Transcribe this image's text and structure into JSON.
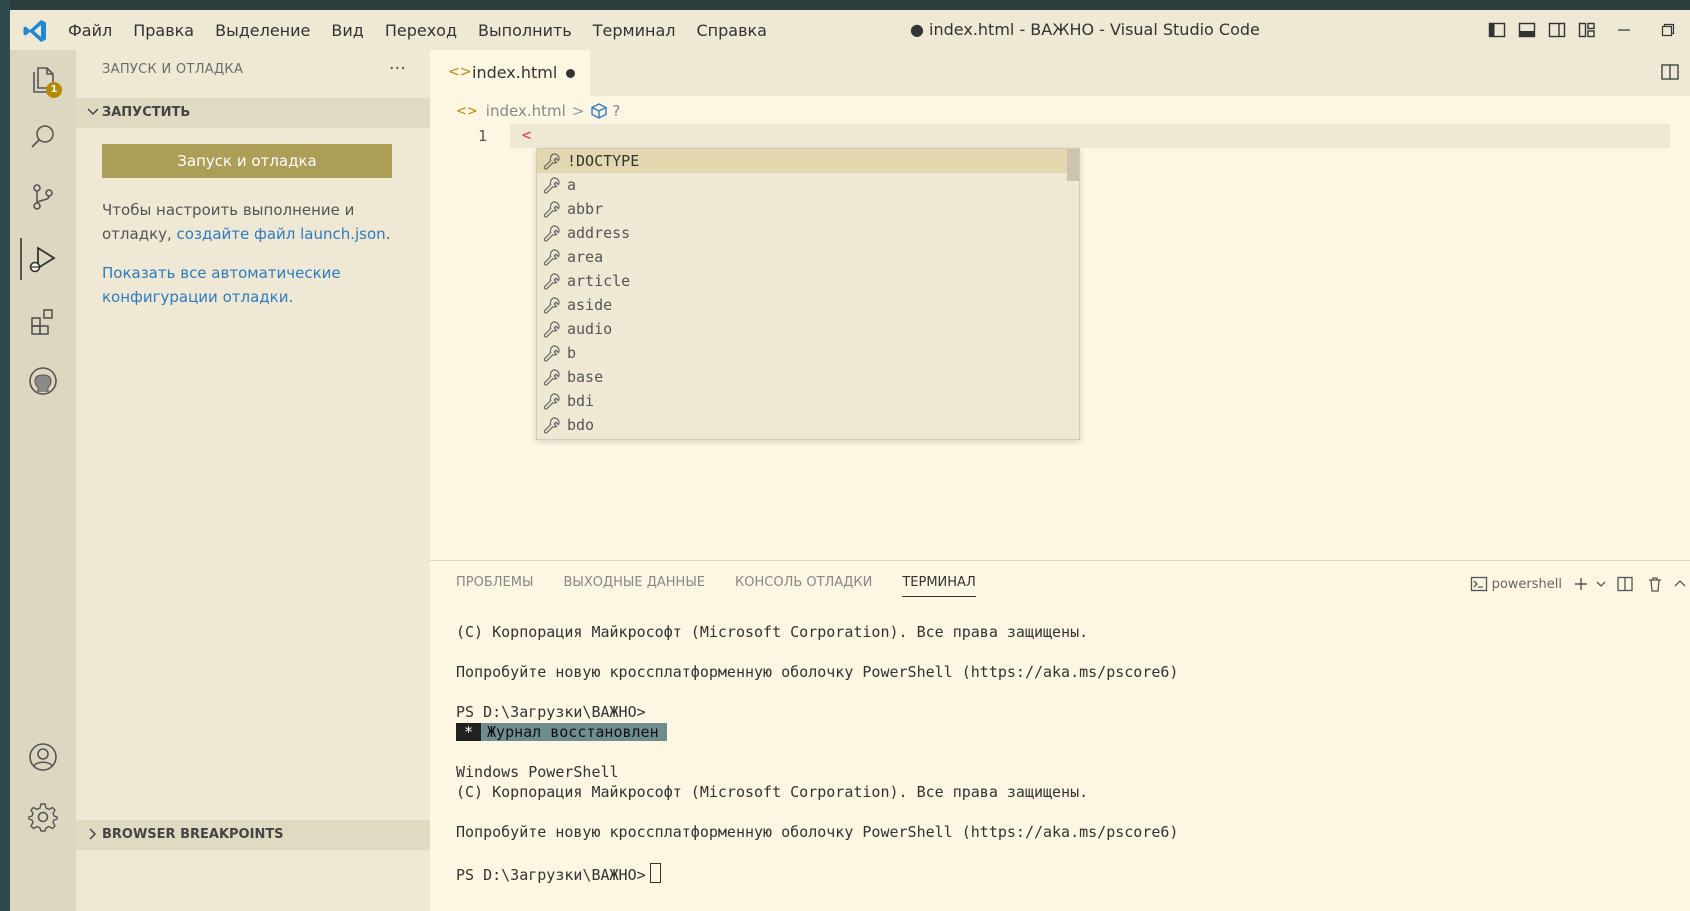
{
  "titlebar": {
    "menu": [
      "Файл",
      "Правка",
      "Выделение",
      "Вид",
      "Переход",
      "Выполнить",
      "Терминал",
      "Справка"
    ],
    "window_title": "● index.html - ВАЖНО - Visual Studio Code"
  },
  "activity_bar": {
    "explorer_badge": "1"
  },
  "sidebar": {
    "title": "ЗАПУСК И ОТЛАДКА",
    "more": "···",
    "section_title": "ЗАПУСТИТЬ",
    "run_button": "Запуск и отладка",
    "configure_text": "Чтобы настроить выполнение и отладку, ",
    "configure_link": "создайте файл launch.json",
    "configure_text_end": ".",
    "auto_configs_link": "Показать все автоматические конфигурации отладки.",
    "bottom_section": "BROWSER BREAKPOINTS"
  },
  "editor": {
    "tab": {
      "icon": "<>",
      "name": "index.html"
    },
    "breadcrumb": {
      "icon": "<>",
      "file": "index.html",
      "separator": ">",
      "symbol": "?"
    },
    "line_number": "1",
    "code": "<",
    "suggestions": [
      "!DOCTYPE",
      "a",
      "abbr",
      "address",
      "area",
      "article",
      "aside",
      "audio",
      "b",
      "base",
      "bdi",
      "bdo"
    ],
    "selected_suggestion_index": 0
  },
  "panel": {
    "tabs": [
      "ПРОБЛЕМЫ",
      "ВЫХОДНЫЕ ДАННЫЕ",
      "КОНСОЛЬ ОТЛАДКИ",
      "ТЕРМИНАЛ"
    ],
    "active_tab_index": 3,
    "shell": "powershell",
    "terminal": {
      "line1": "(C) Корпорация Майкрософт (Microsoft Corporation). Все права защищены.",
      "line2": "Попробуйте новую кроссплатформенную оболочку PowerShell (https://aka.ms/pscore6)",
      "line3": "PS D:\\Загрузки\\ВАЖНО>",
      "restored_star": "*",
      "restored_text": "Журнал восстановлен",
      "line5": "Windows PowerShell",
      "line6": "(C) Корпорация Майкрософт (Microsoft Corporation). Все права защищены.",
      "line7": "Попробуйте новую кроссплатформенную оболочку PowerShell (https://aka.ms/pscore6)",
      "prompt": "PS D:\\Загрузки\\ВАЖНО>"
    }
  },
  "colors": {
    "accent": "#ac9d57",
    "badge": "#b58900",
    "background": "#fdf6e3",
    "sidebar": "#eee8d5",
    "link": "#2f7bbf"
  }
}
